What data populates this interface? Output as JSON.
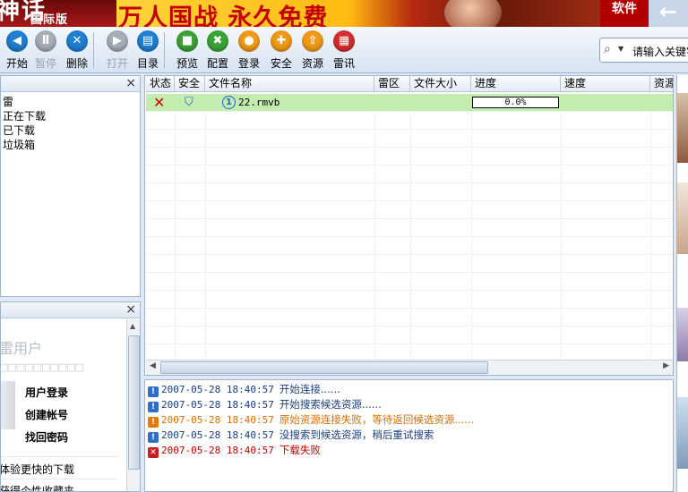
{
  "banner": {
    "logo_text": "神话",
    "logo_sub": "国际版",
    "slogan": "万人国战 永久免费",
    "software_label": "软件",
    "back_arrow": "←"
  },
  "toolbar": {
    "items": [
      {
        "label": "开始",
        "icon": "play-icon",
        "glyph": "◀",
        "color": "blue",
        "disabled": false
      },
      {
        "label": "暂停",
        "icon": "pause-icon",
        "glyph": "Ⅱ",
        "color": "gray",
        "disabled": true
      },
      {
        "label": "删除",
        "icon": "delete-icon",
        "glyph": "✕",
        "color": "blue",
        "disabled": false
      },
      {
        "label": "打开",
        "icon": "open-icon",
        "glyph": "▶",
        "color": "gray",
        "disabled": true
      },
      {
        "label": "目录",
        "icon": "folder-icon",
        "glyph": "▤",
        "color": "blue",
        "disabled": false
      },
      {
        "label": "预览",
        "icon": "preview-icon",
        "glyph": "■",
        "color": "green",
        "disabled": false
      },
      {
        "label": "配置",
        "icon": "config-icon",
        "glyph": "✖",
        "color": "green",
        "disabled": false
      },
      {
        "label": "登录",
        "icon": "login-icon",
        "glyph": "●",
        "color": "orange",
        "disabled": false
      },
      {
        "label": "安全",
        "icon": "shield-icon",
        "glyph": "✚",
        "color": "orange",
        "disabled": false
      },
      {
        "label": "资源",
        "icon": "resource-icon",
        "glyph": "⇧",
        "color": "orange",
        "disabled": false
      },
      {
        "label": "雷讯",
        "icon": "message-icon",
        "glyph": "▦",
        "color": "red",
        "disabled": false
      }
    ]
  },
  "search": {
    "placeholder": "请输入关键字",
    "icon": "search-icon"
  },
  "category_panel": {
    "close_glyph": "×",
    "items": [
      "雷",
      "正在下载",
      "已下载",
      "垃圾箱"
    ]
  },
  "user_panel": {
    "close_glyph": "×",
    "title": "雷用户",
    "boxes": "□□□□□□□□□□",
    "links": [
      {
        "label": "用户登录",
        "color": "#1a3e7a"
      },
      {
        "label": "创建帐号",
        "color": "#c00000"
      },
      {
        "label": "找回密码",
        "color": "#1a3e7a"
      }
    ],
    "footer": [
      "体验更快的下载",
      "获得个性收藏夹"
    ]
  },
  "download_list": {
    "columns": [
      "状态",
      "安全",
      "文件名称",
      "雷区",
      "文件大小",
      "进度",
      "速度",
      "资源"
    ],
    "rows": [
      {
        "status_icon": "x-icon",
        "security_icon": "shield-icon",
        "file_icon": "number-one-icon",
        "filename": "22.rmvb",
        "zone": "",
        "size": "",
        "progress_text": "0.0%",
        "progress_value": 0,
        "speed": "",
        "resource": ""
      }
    ]
  },
  "log": {
    "entries": [
      {
        "level": "info",
        "timestamp": "2007-05-28 18:40:57",
        "message": "开始连接......",
        "color": "#1a3e7a"
      },
      {
        "level": "info",
        "timestamp": "2007-05-28 18:40:57",
        "message": "开始搜索候选资源......",
        "color": "#1a3e7a"
      },
      {
        "level": "warning",
        "timestamp": "2007-05-28 18:40:57",
        "message": "原始资源连接失败，等待返回候选资源......",
        "color": "#d96d00"
      },
      {
        "level": "info",
        "timestamp": "2007-05-28 18:40:57",
        "message": "没搜索到候选资源，稍后重试搜索",
        "color": "#1a3e7a"
      },
      {
        "level": "error",
        "timestamp": "2007-05-28 18:40:57",
        "message": "下载失败",
        "color": "#c00000"
      }
    ]
  },
  "colors": {
    "selected_row": "#c3edae",
    "info": "#1a3e7a",
    "warning": "#d96d00",
    "error": "#c00000"
  }
}
